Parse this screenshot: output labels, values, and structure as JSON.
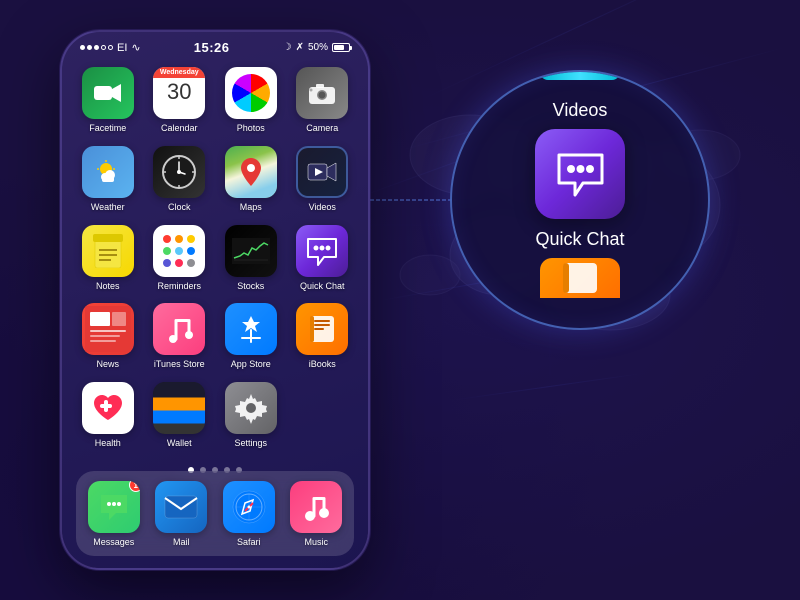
{
  "background": {
    "color": "#1a1040"
  },
  "statusBar": {
    "carrier": "EI",
    "time": "15:26",
    "battery": "50%",
    "bluetooth": true,
    "wifi": true
  },
  "apps": {
    "row1": [
      {
        "id": "facetime",
        "label": "Facetime",
        "icon": "facetime"
      },
      {
        "id": "calendar",
        "label": "Calendar",
        "icon": "calendar",
        "calDay": "30",
        "calMonth": "Wednesday"
      },
      {
        "id": "photos",
        "label": "Photos",
        "icon": "photos"
      },
      {
        "id": "camera",
        "label": "Camera",
        "icon": "camera"
      }
    ],
    "row2": [
      {
        "id": "weather",
        "label": "Weather",
        "icon": "weather"
      },
      {
        "id": "clock",
        "label": "Clock",
        "icon": "clock"
      },
      {
        "id": "maps",
        "label": "Maps",
        "icon": "maps"
      },
      {
        "id": "videos",
        "label": "Videos",
        "icon": "videos"
      }
    ],
    "row3": [
      {
        "id": "notes",
        "label": "Notes",
        "icon": "notes"
      },
      {
        "id": "reminders",
        "label": "Reminders",
        "icon": "reminders"
      },
      {
        "id": "stocks",
        "label": "Stocks",
        "icon": "stocks"
      },
      {
        "id": "quickchat",
        "label": "Quick Chat",
        "icon": "quickchat"
      }
    ],
    "row4": [
      {
        "id": "news",
        "label": "News",
        "icon": "news"
      },
      {
        "id": "itunesstore",
        "label": "iTunes Store",
        "icon": "itunes"
      },
      {
        "id": "appstore",
        "label": "App Store",
        "icon": "appstore"
      },
      {
        "id": "ibooks",
        "label": "iBooks",
        "icon": "ibooks"
      }
    ],
    "row5": [
      {
        "id": "health",
        "label": "Health",
        "icon": "health"
      },
      {
        "id": "wallet",
        "label": "Wallet",
        "icon": "wallet"
      },
      {
        "id": "settings",
        "label": "Settings",
        "icon": "settings"
      }
    ]
  },
  "dock": [
    {
      "id": "messages",
      "label": "Messages",
      "icon": "messages",
      "badge": "1"
    },
    {
      "id": "mail",
      "label": "Mail",
      "icon": "mail"
    },
    {
      "id": "safari",
      "label": "Safari",
      "icon": "safari"
    },
    {
      "id": "music",
      "label": "Music",
      "icon": "music"
    }
  ],
  "zoom": {
    "videosLabel": "Videos",
    "quickchatLabel": "Quick Chat"
  },
  "pageDots": 5,
  "activePageDot": 0
}
